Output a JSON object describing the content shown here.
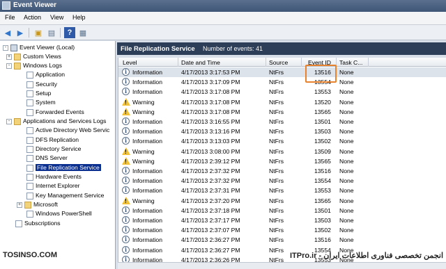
{
  "window": {
    "title": "Event Viewer"
  },
  "menu": [
    "File",
    "Action",
    "View",
    "Help"
  ],
  "toolbar": {
    "icons": [
      "back-arrow-icon",
      "forward-arrow-icon",
      "up-folder-icon",
      "show-hide-tree-icon",
      "help-icon",
      "properties-icon"
    ]
  },
  "tree": {
    "items": [
      {
        "label": "Event Viewer (Local)",
        "icon": "computer-icon",
        "level": 0,
        "expander": "-"
      },
      {
        "label": "Custom Views",
        "icon": "folder-icon",
        "level": 1,
        "expander": "+"
      },
      {
        "label": "Windows Logs",
        "icon": "folder-icon",
        "level": 1,
        "expander": "-"
      },
      {
        "label": "Application",
        "icon": "log-icon",
        "level": 2
      },
      {
        "label": "Security",
        "icon": "log-icon",
        "level": 2
      },
      {
        "label": "Setup",
        "icon": "log-icon",
        "level": 2
      },
      {
        "label": "System",
        "icon": "log-icon",
        "level": 2
      },
      {
        "label": "Forwarded Events",
        "icon": "log-icon",
        "level": 2
      },
      {
        "label": "Applications and Services Logs",
        "icon": "folder-icon",
        "level": 1,
        "expander": "-"
      },
      {
        "label": "Active Directory Web Servic",
        "icon": "log-icon",
        "level": 2
      },
      {
        "label": "DFS Replication",
        "icon": "log-icon",
        "level": 2
      },
      {
        "label": "Directory Service",
        "icon": "log-icon",
        "level": 2
      },
      {
        "label": "DNS Server",
        "icon": "log-icon",
        "level": 2
      },
      {
        "label": "File Replication Service",
        "icon": "log-icon",
        "level": 2,
        "selected": true
      },
      {
        "label": "Hardware Events",
        "icon": "log-icon",
        "level": 2
      },
      {
        "label": "Internet Explorer",
        "icon": "log-icon",
        "level": 2
      },
      {
        "label": "Key Management Service",
        "icon": "log-icon",
        "level": 2
      },
      {
        "label": "Microsoft",
        "icon": "folder-icon",
        "level": 2,
        "expander": "+"
      },
      {
        "label": "Windows PowerShell",
        "icon": "log-icon",
        "level": 2
      },
      {
        "label": "Subscriptions",
        "icon": "log-icon",
        "level": 1
      }
    ]
  },
  "pane": {
    "title": "File Replication Service",
    "count": "Number of events: 41"
  },
  "columns": [
    "Level",
    "Date and Time",
    "Source",
    "Event ID",
    "Task C..."
  ],
  "rows": [
    {
      "level": "Information",
      "icon": "info",
      "date": "4/17/2013 3:17:53 PM",
      "source": "NtFrs",
      "id": "13516",
      "task": "None",
      "selected": true
    },
    {
      "level": "Information",
      "icon": "info",
      "date": "4/17/2013 3:17:09 PM",
      "source": "NtFrs",
      "id": "13554",
      "task": "None"
    },
    {
      "level": "Information",
      "icon": "info",
      "date": "4/17/2013 3:17:08 PM",
      "source": "NtFrs",
      "id": "13553",
      "task": "None"
    },
    {
      "level": "Warning",
      "icon": "warn",
      "date": "4/17/2013 3:17:08 PM",
      "source": "NtFrs",
      "id": "13520",
      "task": "None"
    },
    {
      "level": "Warning",
      "icon": "warn",
      "date": "4/17/2013 3:17:08 PM",
      "source": "NtFrs",
      "id": "13565",
      "task": "None"
    },
    {
      "level": "Information",
      "icon": "info",
      "date": "4/17/2013 3:16:55 PM",
      "source": "NtFrs",
      "id": "13501",
      "task": "None"
    },
    {
      "level": "Information",
      "icon": "info",
      "date": "4/17/2013 3:13:16 PM",
      "source": "NtFrs",
      "id": "13503",
      "task": "None"
    },
    {
      "level": "Information",
      "icon": "info",
      "date": "4/17/2013 3:13:03 PM",
      "source": "NtFrs",
      "id": "13502",
      "task": "None"
    },
    {
      "level": "Warning",
      "icon": "warn",
      "date": "4/17/2013 3:08:00 PM",
      "source": "NtFrs",
      "id": "13509",
      "task": "None"
    },
    {
      "level": "Warning",
      "icon": "warn",
      "date": "4/17/2013 2:39:12 PM",
      "source": "NtFrs",
      "id": "13565",
      "task": "None"
    },
    {
      "level": "Information",
      "icon": "info",
      "date": "4/17/2013 2:37:32 PM",
      "source": "NtFrs",
      "id": "13516",
      "task": "None"
    },
    {
      "level": "Information",
      "icon": "info",
      "date": "4/17/2013 2:37:32 PM",
      "source": "NtFrs",
      "id": "13554",
      "task": "None"
    },
    {
      "level": "Information",
      "icon": "info",
      "date": "4/17/2013 2:37:31 PM",
      "source": "NtFrs",
      "id": "13553",
      "task": "None"
    },
    {
      "level": "Warning",
      "icon": "warn",
      "date": "4/17/2013 2:37:20 PM",
      "source": "NtFrs",
      "id": "13565",
      "task": "None"
    },
    {
      "level": "Information",
      "icon": "info",
      "date": "4/17/2013 2:37:18 PM",
      "source": "NtFrs",
      "id": "13501",
      "task": "None"
    },
    {
      "level": "Information",
      "icon": "info",
      "date": "4/17/2013 2:37:17 PM",
      "source": "NtFrs",
      "id": "13503",
      "task": "None"
    },
    {
      "level": "Information",
      "icon": "info",
      "date": "4/17/2013 2:37:07 PM",
      "source": "NtFrs",
      "id": "13502",
      "task": "None"
    },
    {
      "level": "Information",
      "icon": "info",
      "date": "4/17/2013 2:36:27 PM",
      "source": "NtFrs",
      "id": "13516",
      "task": "None"
    },
    {
      "level": "Information",
      "icon": "info",
      "date": "4/17/2013 2:36:27 PM",
      "source": "NtFrs",
      "id": "13554",
      "task": "None"
    },
    {
      "level": "Information",
      "icon": "info",
      "date": "4/17/2013 2:36:26 PM",
      "source": "NtFrs",
      "id": "13553",
      "task": "None"
    }
  ],
  "highlight_color": "#e8822c",
  "watermark": {
    "left": "TOSINSO.COM",
    "right": "ITPro.ir - انجمن تخصصی فناوری اطلاعات ایران"
  }
}
